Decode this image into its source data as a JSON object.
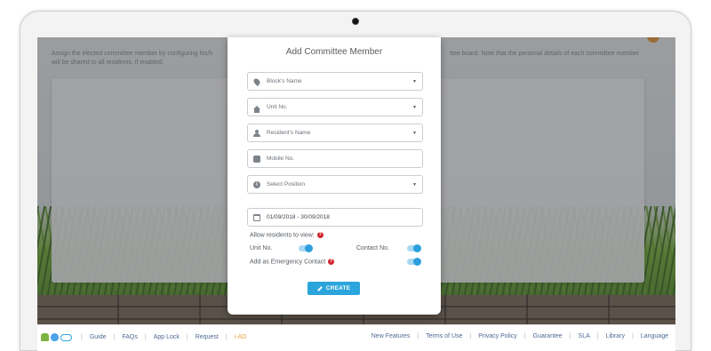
{
  "page": {
    "intro_left": "Assign the elected committee member by configuring his/h",
    "intro_left_2": "will be shared to all residents, if enabled.",
    "intro_right": "ttee board. Note that the personal details of each committee member"
  },
  "modal": {
    "title": "Add Committee Member",
    "fields": {
      "block_placeholder": "Block's Name",
      "unit_placeholder": "Unit No.",
      "resident_placeholder": "Resident's Name",
      "mobile_placeholder": "Mobile No.",
      "position_placeholder": "Select Position",
      "date_range": "01/09/2018 - 30/09/2018"
    },
    "allow_label": "Allow residents to view:",
    "unit_toggle_label": "Unit No.",
    "contact_toggle_label": "Contact No.",
    "emergency_label": "Add as Emergency Contact",
    "create_label": "CREATE"
  },
  "footer": {
    "left_links": [
      "Guide",
      "FAQs",
      "App Lock",
      "Request",
      "i-AD"
    ],
    "right_links": [
      "New Features",
      "Terms of Use",
      "Privacy Policy",
      "Guarantee",
      "SLA",
      "Library",
      "Language"
    ]
  },
  "colors": {
    "accent": "#2ba5dc",
    "active_link": "#e8a23c",
    "help": "#d0262d"
  }
}
